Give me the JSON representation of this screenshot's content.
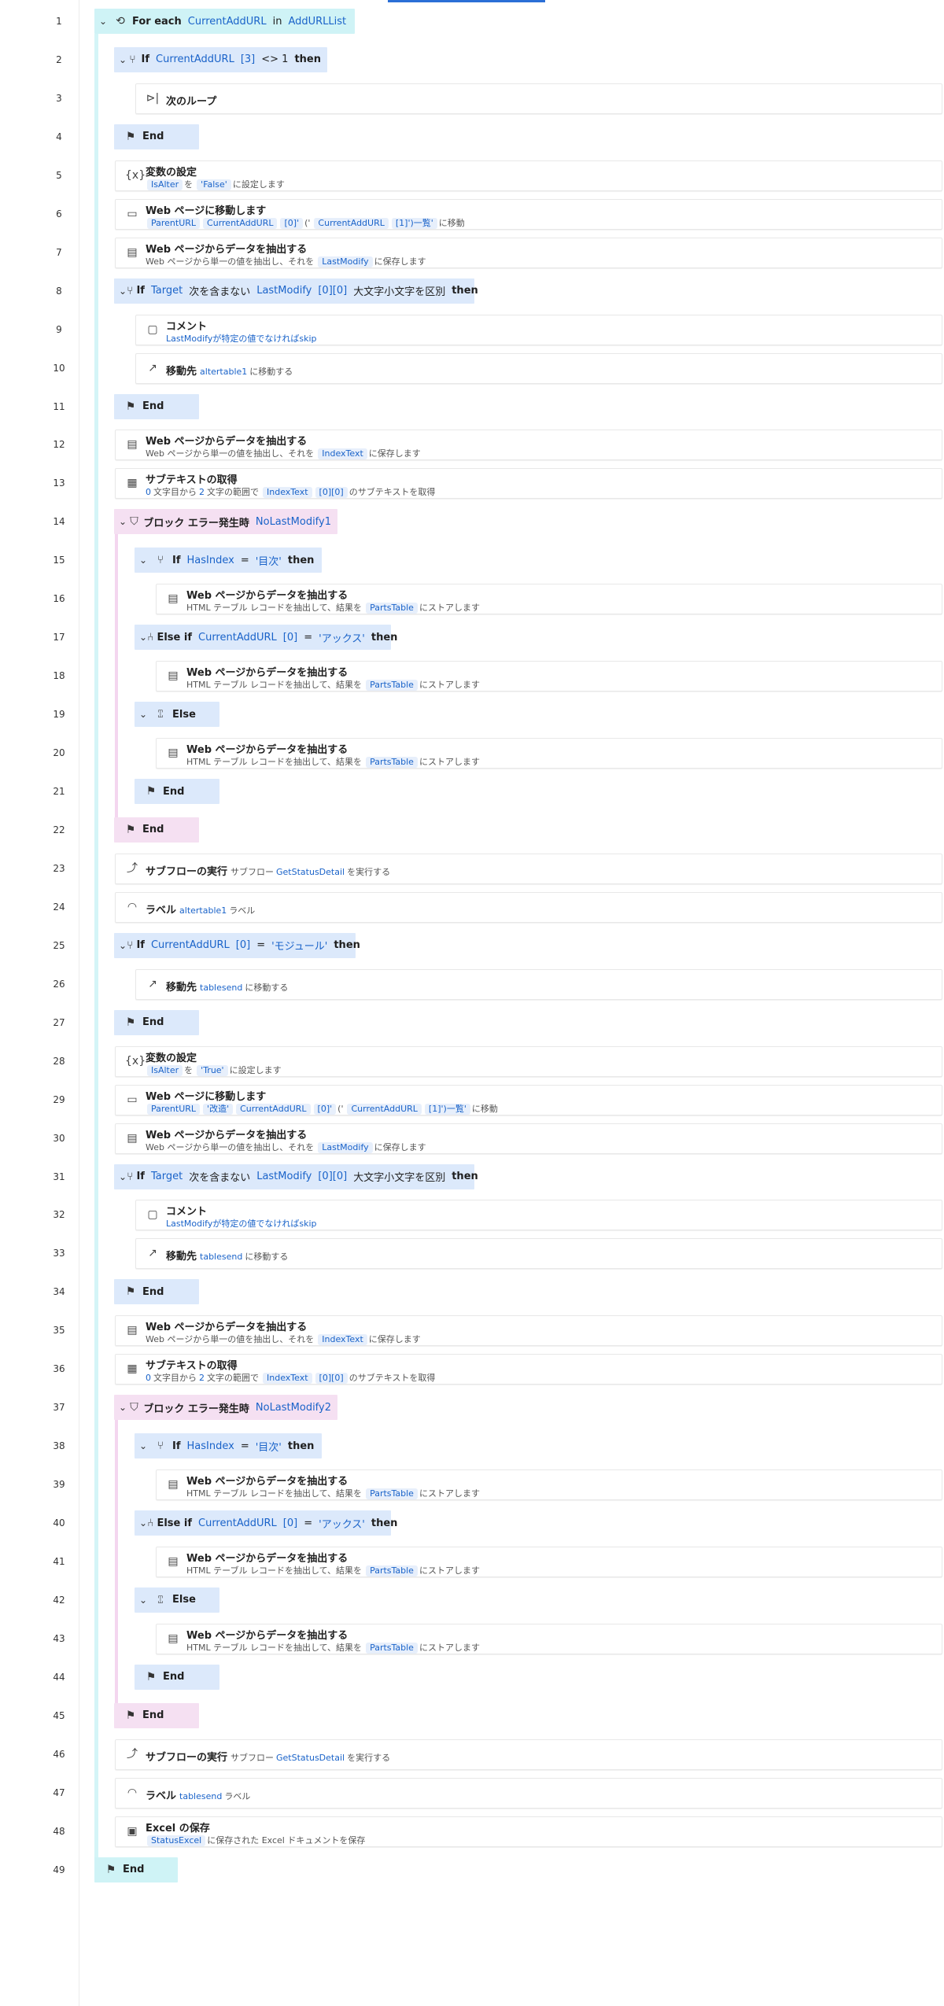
{
  "window": {
    "accent": "#2b6fd6"
  },
  "line_numbers": [
    "1",
    "2",
    "3",
    "4",
    "5",
    "6",
    "7",
    "8",
    "9",
    "10",
    "11",
    "12",
    "13",
    "14",
    "15",
    "16",
    "17",
    "18",
    "19",
    "20",
    "21",
    "22",
    "23",
    "24",
    "25",
    "26",
    "27",
    "28",
    "29",
    "30",
    "31",
    "32",
    "33",
    "34",
    "35",
    "36",
    "37",
    "38",
    "39",
    "40",
    "41",
    "42",
    "43",
    "44",
    "45",
    "46",
    "47",
    "48",
    "49"
  ],
  "steps": [
    {
      "line": 1,
      "kind": "foreach",
      "depth": 0,
      "icon": "loop-icon",
      "parts": [
        {
          "t": "kw",
          "v": "For each"
        },
        {
          "t": "var",
          "v": "CurrentAddURL"
        },
        {
          "t": "lit",
          "v": "in"
        },
        {
          "t": "var",
          "v": "AddURLList"
        }
      ]
    },
    {
      "line": 2,
      "kind": "if",
      "depth": 1,
      "icon": "branch-icon",
      "parts": [
        {
          "t": "kw",
          "v": "If"
        },
        {
          "t": "var",
          "v": "CurrentAddURL"
        },
        {
          "t": "var",
          "v": "[3]"
        },
        {
          "t": "lit",
          "v": "<> 1"
        },
        {
          "t": "kw",
          "v": "then"
        }
      ]
    },
    {
      "line": 3,
      "kind": "action",
      "depth": 2,
      "icon": "next-loop-icon",
      "title": "次のループ",
      "desc": []
    },
    {
      "line": 4,
      "kind": "end",
      "depth": 1,
      "icon": "flag-icon",
      "label": "End"
    },
    {
      "line": 5,
      "kind": "action",
      "depth": 1,
      "icon": "variable-icon",
      "title": "変数の設定",
      "desc": [
        {
          "c": "IsAlter"
        },
        {
          "s": "を"
        },
        {
          "c": "'False'"
        },
        {
          "s": "に設定します"
        }
      ]
    },
    {
      "line": 6,
      "kind": "action",
      "depth": 1,
      "icon": "browser-icon",
      "title": "Web ページに移動します",
      "desc": [
        {
          "c": "ParentURL"
        },
        {
          "c": "CurrentAddURL"
        },
        {
          "c": "[0]'"
        },
        {
          "s": "('"
        },
        {
          "c": "CurrentAddURL"
        },
        {
          "c": "[1]')一覧'"
        },
        {
          "s": "に移動"
        }
      ]
    },
    {
      "line": 7,
      "kind": "action",
      "depth": 1,
      "icon": "extract-icon",
      "title": "Web ページからデータを抽出する",
      "desc": [
        {
          "s": "Web ページから単一の値を抽出し、それを"
        },
        {
          "c": "LastModify"
        },
        {
          "s": "に保存します"
        }
      ]
    },
    {
      "line": 8,
      "kind": "if",
      "depth": 1,
      "icon": "branch-icon",
      "parts": [
        {
          "t": "kw",
          "v": "If"
        },
        {
          "t": "var",
          "v": "Target"
        },
        {
          "t": "lit",
          "v": "次を含まない"
        },
        {
          "t": "var",
          "v": "LastModify"
        },
        {
          "t": "var",
          "v": "[0][0]"
        },
        {
          "t": "lit",
          "v": "大文字小文字を区別"
        },
        {
          "t": "kw",
          "v": "then"
        }
      ]
    },
    {
      "line": 9,
      "kind": "action",
      "depth": 2,
      "icon": "comment-icon",
      "title": "コメント",
      "desc": [
        {
          "b": "LastModifyが特定の値でなければskip"
        }
      ]
    },
    {
      "line": 10,
      "kind": "action",
      "depth": 2,
      "icon": "goto-icon",
      "title": "移動先",
      "inline": true,
      "desc": [
        {
          "b": "altertable1"
        },
        {
          "s": "に移動する"
        }
      ]
    },
    {
      "line": 11,
      "kind": "end",
      "depth": 1,
      "icon": "flag-icon",
      "label": "End"
    },
    {
      "line": 12,
      "kind": "action",
      "depth": 1,
      "icon": "extract-icon",
      "title": "Web ページからデータを抽出する",
      "desc": [
        {
          "s": "Web ページから単一の値を抽出し、それを"
        },
        {
          "c": "IndexText"
        },
        {
          "s": "に保存します"
        }
      ]
    },
    {
      "line": 13,
      "kind": "action",
      "depth": 1,
      "icon": "subtext-icon",
      "title": "サブテキストの取得",
      "desc": [
        {
          "b": "0"
        },
        {
          "s": "文字目から"
        },
        {
          "b": "2"
        },
        {
          "s": "文字の範囲で"
        },
        {
          "c": "IndexText"
        },
        {
          "c": "[0][0]"
        },
        {
          "s": "のサブテキストを取得"
        }
      ]
    },
    {
      "line": 14,
      "kind": "err",
      "depth": 1,
      "icon": "shield-icon",
      "parts": [
        {
          "t": "kw",
          "v": "ブロック エラー発生時"
        },
        {
          "t": "var",
          "v": "NoLastModify1"
        }
      ]
    },
    {
      "line": 15,
      "kind": "if",
      "depth": 2,
      "icon": "branch-icon",
      "parts": [
        {
          "t": "kw",
          "v": "If"
        },
        {
          "t": "var",
          "v": "HasIndex"
        },
        {
          "t": "lit",
          "v": "="
        },
        {
          "t": "var",
          "v": "'目次'"
        },
        {
          "t": "kw",
          "v": "then"
        }
      ]
    },
    {
      "line": 16,
      "kind": "action",
      "depth": 3,
      "icon": "extract-icon",
      "title": "Web ページからデータを抽出する",
      "desc": [
        {
          "s": "HTML テーブル レコードを抽出して、結果を"
        },
        {
          "c": "PartsTable"
        },
        {
          "s": "にストアします"
        }
      ]
    },
    {
      "line": 17,
      "kind": "if",
      "depth": 2,
      "icon": "elseif-icon",
      "parts": [
        {
          "t": "kw",
          "v": "Else if"
        },
        {
          "t": "var",
          "v": "CurrentAddURL"
        },
        {
          "t": "var",
          "v": "[0]"
        },
        {
          "t": "lit",
          "v": "="
        },
        {
          "t": "var",
          "v": "'アックス'"
        },
        {
          "t": "kw",
          "v": "then"
        }
      ]
    },
    {
      "line": 18,
      "kind": "action",
      "depth": 3,
      "icon": "extract-icon",
      "title": "Web ページからデータを抽出する",
      "desc": [
        {
          "s": "HTML テーブル レコードを抽出して、結果を"
        },
        {
          "c": "PartsTable"
        },
        {
          "s": "にストアします"
        }
      ]
    },
    {
      "line": 19,
      "kind": "if",
      "depth": 2,
      "icon": "else-icon",
      "parts": [
        {
          "t": "kw",
          "v": "Else"
        }
      ]
    },
    {
      "line": 20,
      "kind": "action",
      "depth": 3,
      "icon": "extract-icon",
      "title": "Web ページからデータを抽出する",
      "desc": [
        {
          "s": "HTML テーブル レコードを抽出して、結果を"
        },
        {
          "c": "PartsTable"
        },
        {
          "s": "にストアします"
        }
      ]
    },
    {
      "line": 21,
      "kind": "end",
      "depth": 2,
      "icon": "flag-icon",
      "label": "End"
    },
    {
      "line": 22,
      "kind": "errend",
      "depth": 1,
      "icon": "flag-icon",
      "label": "End"
    },
    {
      "line": 23,
      "kind": "action",
      "depth": 1,
      "icon": "subflow-icon",
      "title": "サブフローの実行",
      "inline": true,
      "desc": [
        {
          "s": "サブフロー"
        },
        {
          "b": "GetStatusDetail"
        },
        {
          "s": "を実行する"
        }
      ]
    },
    {
      "line": 24,
      "kind": "action",
      "depth": 1,
      "icon": "label-icon",
      "title": "ラベル",
      "inline": true,
      "desc": [
        {
          "b": "altertable1"
        },
        {
          "s": "ラベル"
        }
      ]
    },
    {
      "line": 25,
      "kind": "if",
      "depth": 1,
      "icon": "branch-icon",
      "parts": [
        {
          "t": "kw",
          "v": "If"
        },
        {
          "t": "var",
          "v": "CurrentAddURL"
        },
        {
          "t": "var",
          "v": "[0]"
        },
        {
          "t": "lit",
          "v": "="
        },
        {
          "t": "var",
          "v": "'モジュール'"
        },
        {
          "t": "kw",
          "v": "then"
        }
      ]
    },
    {
      "line": 26,
      "kind": "action",
      "depth": 2,
      "icon": "goto-icon",
      "title": "移動先",
      "inline": true,
      "desc": [
        {
          "b": "tablesend"
        },
        {
          "s": "に移動する"
        }
      ]
    },
    {
      "line": 27,
      "kind": "end",
      "depth": 1,
      "icon": "flag-icon",
      "label": "End"
    },
    {
      "line": 28,
      "kind": "action",
      "depth": 1,
      "icon": "variable-icon",
      "title": "変数の設定",
      "desc": [
        {
          "c": "IsAlter"
        },
        {
          "s": "を"
        },
        {
          "c": "'True'"
        },
        {
          "s": "に設定します"
        }
      ]
    },
    {
      "line": 29,
      "kind": "action",
      "depth": 1,
      "icon": "browser-icon",
      "title": "Web ページに移動します",
      "desc": [
        {
          "c": "ParentURL"
        },
        {
          "c": "'改造'"
        },
        {
          "c": "CurrentAddURL"
        },
        {
          "c": "[0]'"
        },
        {
          "s": "('"
        },
        {
          "c": "CurrentAddURL"
        },
        {
          "c": "[1]')一覧'"
        },
        {
          "s": "に移動"
        }
      ]
    },
    {
      "line": 30,
      "kind": "action",
      "depth": 1,
      "icon": "extract-icon",
      "title": "Web ページからデータを抽出する",
      "desc": [
        {
          "s": "Web ページから単一の値を抽出し、それを"
        },
        {
          "c": "LastModify"
        },
        {
          "s": "に保存します"
        }
      ]
    },
    {
      "line": 31,
      "kind": "if",
      "depth": 1,
      "icon": "branch-icon",
      "parts": [
        {
          "t": "kw",
          "v": "If"
        },
        {
          "t": "var",
          "v": "Target"
        },
        {
          "t": "lit",
          "v": "次を含まない"
        },
        {
          "t": "var",
          "v": "LastModify"
        },
        {
          "t": "var",
          "v": "[0][0]"
        },
        {
          "t": "lit",
          "v": "大文字小文字を区別"
        },
        {
          "t": "kw",
          "v": "then"
        }
      ]
    },
    {
      "line": 32,
      "kind": "action",
      "depth": 2,
      "icon": "comment-icon",
      "title": "コメント",
      "desc": [
        {
          "b": "LastModifyが特定の値でなければskip"
        }
      ]
    },
    {
      "line": 33,
      "kind": "action",
      "depth": 2,
      "icon": "goto-icon",
      "title": "移動先",
      "inline": true,
      "desc": [
        {
          "b": "tablesend"
        },
        {
          "s": "に移動する"
        }
      ]
    },
    {
      "line": 34,
      "kind": "end",
      "depth": 1,
      "icon": "flag-icon",
      "label": "End"
    },
    {
      "line": 35,
      "kind": "action",
      "depth": 1,
      "icon": "extract-icon",
      "title": "Web ページからデータを抽出する",
      "desc": [
        {
          "s": "Web ページから単一の値を抽出し、それを"
        },
        {
          "c": "IndexText"
        },
        {
          "s": "に保存します"
        }
      ]
    },
    {
      "line": 36,
      "kind": "action",
      "depth": 1,
      "icon": "subtext-icon",
      "title": "サブテキストの取得",
      "desc": [
        {
          "b": "0"
        },
        {
          "s": "文字目から"
        },
        {
          "b": "2"
        },
        {
          "s": "文字の範囲で"
        },
        {
          "c": "IndexText"
        },
        {
          "c": "[0][0]"
        },
        {
          "s": "のサブテキストを取得"
        }
      ]
    },
    {
      "line": 37,
      "kind": "err",
      "depth": 1,
      "icon": "shield-icon",
      "parts": [
        {
          "t": "kw",
          "v": "ブロック エラー発生時"
        },
        {
          "t": "var",
          "v": "NoLastModify2"
        }
      ]
    },
    {
      "line": 38,
      "kind": "if",
      "depth": 2,
      "icon": "branch-icon",
      "parts": [
        {
          "t": "kw",
          "v": "If"
        },
        {
          "t": "var",
          "v": "HasIndex"
        },
        {
          "t": "lit",
          "v": "="
        },
        {
          "t": "var",
          "v": "'目次'"
        },
        {
          "t": "kw",
          "v": "then"
        }
      ]
    },
    {
      "line": 39,
      "kind": "action",
      "depth": 3,
      "icon": "extract-icon",
      "title": "Web ページからデータを抽出する",
      "desc": [
        {
          "s": "HTML テーブル レコードを抽出して、結果を"
        },
        {
          "c": "PartsTable"
        },
        {
          "s": "にストアします"
        }
      ]
    },
    {
      "line": 40,
      "kind": "if",
      "depth": 2,
      "icon": "elseif-icon",
      "parts": [
        {
          "t": "kw",
          "v": "Else if"
        },
        {
          "t": "var",
          "v": "CurrentAddURL"
        },
        {
          "t": "var",
          "v": "[0]"
        },
        {
          "t": "lit",
          "v": "="
        },
        {
          "t": "var",
          "v": "'アックス'"
        },
        {
          "t": "kw",
          "v": "then"
        }
      ]
    },
    {
      "line": 41,
      "kind": "action",
      "depth": 3,
      "icon": "extract-icon",
      "title": "Web ページからデータを抽出する",
      "desc": [
        {
          "s": "HTML テーブル レコードを抽出して、結果を"
        },
        {
          "c": "PartsTable"
        },
        {
          "s": "にストアします"
        }
      ]
    },
    {
      "line": 42,
      "kind": "if",
      "depth": 2,
      "icon": "else-icon",
      "parts": [
        {
          "t": "kw",
          "v": "Else"
        }
      ]
    },
    {
      "line": 43,
      "kind": "action",
      "depth": 3,
      "icon": "extract-icon",
      "title": "Web ページからデータを抽出する",
      "desc": [
        {
          "s": "HTML テーブル レコードを抽出して、結果を"
        },
        {
          "c": "PartsTable"
        },
        {
          "s": "にストアします"
        }
      ]
    },
    {
      "line": 44,
      "kind": "end",
      "depth": 2,
      "icon": "flag-icon",
      "label": "End"
    },
    {
      "line": 45,
      "kind": "errend",
      "depth": 1,
      "icon": "flag-icon",
      "label": "End"
    },
    {
      "line": 46,
      "kind": "action",
      "depth": 1,
      "icon": "subflow-icon",
      "title": "サブフローの実行",
      "inline": true,
      "desc": [
        {
          "s": "サブフロー"
        },
        {
          "b": "GetStatusDetail"
        },
        {
          "s": "を実行する"
        }
      ]
    },
    {
      "line": 47,
      "kind": "action",
      "depth": 1,
      "icon": "label-icon",
      "title": "ラベル",
      "inline": true,
      "desc": [
        {
          "b": "tablesend"
        },
        {
          "s": "ラベル"
        }
      ]
    },
    {
      "line": 48,
      "kind": "action",
      "depth": 1,
      "icon": "excel-icon",
      "title": "Excel の保存",
      "desc": [
        {
          "c": "StatusExcel"
        },
        {
          "s": "に保存された Excel ドキュメントを保存"
        }
      ]
    },
    {
      "line": 49,
      "kind": "foreachend",
      "depth": 0,
      "icon": "flag-icon",
      "label": "End"
    }
  ]
}
